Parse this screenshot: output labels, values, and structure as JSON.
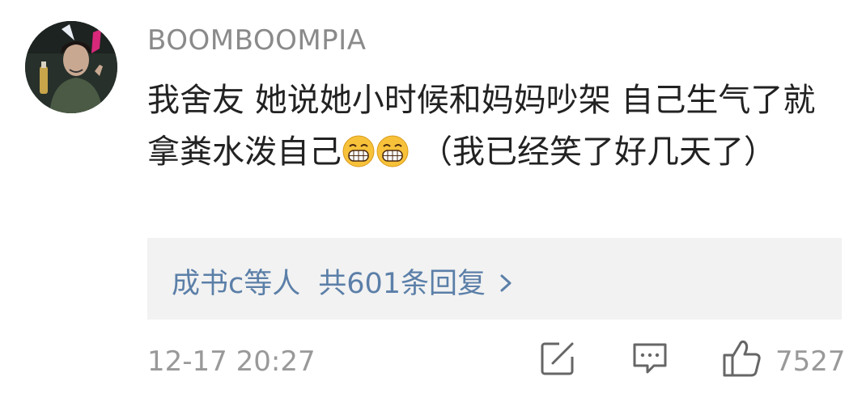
{
  "comment": {
    "username": "BOOMBOOMPIA",
    "text_before_emoji": "我舍友 她说她小时候和妈妈吵架 自己生气了就拿粪水泼自己",
    "emoji_count": 2,
    "emoji_name": "grinning-face-icon",
    "text_after_emoji": "（我已经笑了好几天了）",
    "replies_summary": {
      "names": "成书c等人",
      "count_label": "共601条回复",
      "chevron": "chevron-right-icon"
    },
    "timestamp": "12-17 20:27",
    "actions": {
      "repost_icon": "share-edit-icon",
      "comment_icon": "comment-bubble-icon",
      "like_icon": "thumbs-up-icon",
      "like_count": "7527"
    }
  },
  "colors": {
    "username": "#8a8a8a",
    "body_text": "#222222",
    "link": "#5b7fa8",
    "reply_bg": "#f2f2f2",
    "meta": "#999999"
  }
}
